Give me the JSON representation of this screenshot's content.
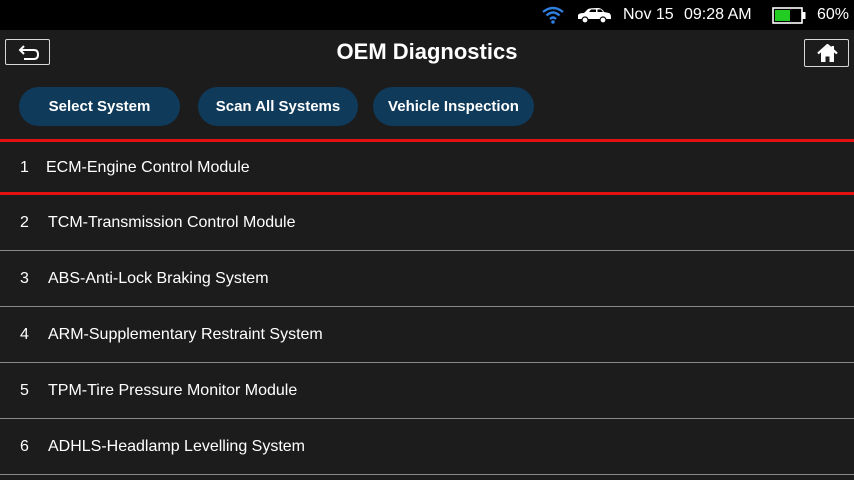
{
  "status_bar": {
    "wifi_icon": "wifi-icon",
    "car_icon": "car-icon",
    "date": "Nov 15",
    "time": "09:28 AM",
    "battery_icon": "battery-icon",
    "battery_level": 0.6,
    "battery_percent": "60%"
  },
  "header": {
    "back_icon": "back-arrow-icon",
    "title": "OEM Diagnostics",
    "home_icon": "home-icon"
  },
  "tabs": [
    {
      "label": "Select System"
    },
    {
      "label": "Scan All Systems"
    },
    {
      "label": "Vehicle Inspection"
    }
  ],
  "systems": [
    {
      "num": "1",
      "label": "ECM-Engine Control Module",
      "selected": true
    },
    {
      "num": "2",
      "label": "TCM-Transmission Control Module",
      "selected": false
    },
    {
      "num": "3",
      "label": "ABS-Anti-Lock Braking System",
      "selected": false
    },
    {
      "num": "4",
      "label": "ARM-Supplementary Restraint System",
      "selected": false
    },
    {
      "num": "5",
      "label": "TPM-Tire Pressure Monitor Module",
      "selected": false
    },
    {
      "num": "6",
      "label": "ADHLS-Headlamp Levelling System",
      "selected": false
    }
  ],
  "colors": {
    "accent_blue": "#0f3a5a",
    "selection_red": "#e31212",
    "wifi_blue": "#2f7fe0",
    "battery_green": "#22cc22",
    "background": "#1c1c1c"
  }
}
